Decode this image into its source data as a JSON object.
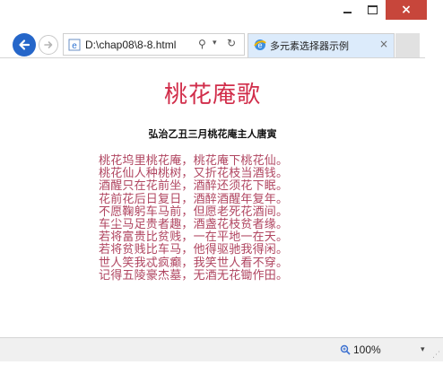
{
  "window": {
    "controls": {
      "minimize_icon": "minimize-icon",
      "maximize_icon": "maximize-icon",
      "close_label": "×"
    }
  },
  "nav": {
    "address": "D:\\chap08\\8-8.html",
    "search_glyph": "⚲",
    "dropdown_glyph": "▾",
    "refresh_glyph": "↻"
  },
  "tab": {
    "title": "多元素选择器示例",
    "close_label": "×"
  },
  "page": {
    "title": "桃花庵歌",
    "subtitle": "弘治乙丑三月桃花庵主人唐寅",
    "poem": [
      "桃花坞里桃花庵，桃花庵下桃花仙。",
      "桃花仙人种桃树，又折花枝当酒钱。",
      "酒醒只在花前坐，酒醉还须花下眠。",
      "花前花后日复日，酒醉酒醒年复年。",
      "不愿鞠躬车马前，但愿老死花酒间。",
      "车尘马足贵者趣，酒盏花枝贫者缘。",
      "若将富贵比贫贱，一在平地一在天。",
      "若将贫贱比车马，他得驱驰我得闲。",
      "世人笑我忒疯癫，我笑世人看不穿。",
      "记得五陵豪杰墓，无酒无花锄作田。"
    ]
  },
  "status": {
    "zoom": "100%",
    "zoom_dropdown": "▾"
  },
  "colors": {
    "title": "#d12d4a",
    "poem": "#b04560",
    "back_button": "#2566c9",
    "close_button": "#c7463b",
    "tab_active": "#dcebfb"
  }
}
